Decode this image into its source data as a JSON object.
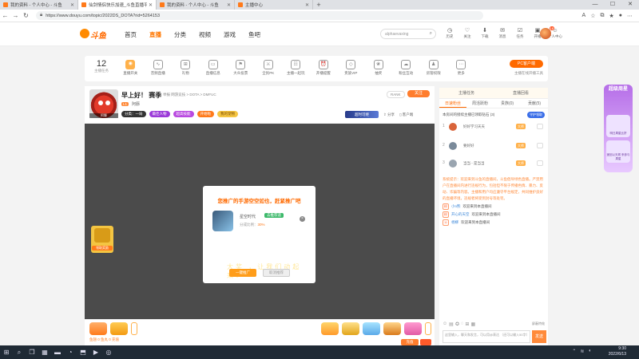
{
  "browser": {
    "tabs": [
      {
        "title": "我的资料 - 个人中心 - 斗鱼"
      },
      {
        "title": "仙剑情侣快乐加速_斗鱼直播平台"
      },
      {
        "title": "我的资料 - 个人中心 - 斗鱼"
      },
      {
        "title": "主播中心"
      }
    ],
    "url": "https://www.douyu.com/topic/2022DS_DOTA?rid=5264153"
  },
  "site": {
    "logo": "斗鱼",
    "nav": [
      "首页",
      "直播",
      "分类",
      "视频",
      "游戏",
      "鱼吧"
    ],
    "search_placeholder": "alphaevaxing",
    "header_icons": [
      {
        "icon": "history-icon",
        "label": "历史"
      },
      {
        "icon": "follow-icon",
        "label": "关注"
      },
      {
        "icon": "download-icon",
        "label": "下载"
      },
      {
        "icon": "message-icon",
        "label": "消息"
      },
      {
        "icon": "task-icon",
        "label": "任务"
      },
      {
        "icon": "gift-icon",
        "label": "开播"
      },
      {
        "icon": "user-icon",
        "label": "个人中心"
      }
    ],
    "avatar_badge": "18"
  },
  "funcbar": {
    "level": "12",
    "level_label": "主播任务",
    "items": [
      "直播开关",
      "音频直播",
      "礼物",
      "直播信息",
      "大众投票",
      "全民PK",
      "主播一起玩",
      "开播提醒",
      "贵族VIP",
      "抽奖",
      "粉丝互动",
      "房管权限",
      "更多"
    ],
    "pc_button": "PC客户端",
    "pc_link": "主播在线开播工具"
  },
  "room": {
    "title": "早上好！",
    "subtitle": "赛季",
    "meta": "举报  网游竞技 > DOTA > DMFUC",
    "host": "阿豚",
    "level": "L1",
    "tags": [
      "分类：一局",
      "最佳人物",
      "超高技能",
      "开始啦",
      "我的宠物"
    ],
    "report": "RANK",
    "follow": "关注",
    "pk_banner": "超时可继",
    "share": "分享",
    "fullscreen": "客户端"
  },
  "video": {
    "chest_label": "领取奖励",
    "modal": {
      "title": "您推广的手游空空如也，赶紧推广吧",
      "game_name": "星空时代",
      "game_badge": "去推荐道",
      "share_label": "分成比例：",
      "share_value": "30%",
      "ghost_text": "大奖 ，让我们动起来！",
      "primary_btn": "一键推广",
      "secondary_btn": "取消推荐"
    }
  },
  "giftbar": {
    "currency": "鱼翅 0 鱼丸 0 充值",
    "recharge": "充值"
  },
  "rpanel": {
    "top_tabs": [
      "主播任务",
      "直播回看"
    ],
    "tabs": [
      "日速粉丝",
      "周活跃粉",
      "贵族(0)",
      "贡献(5)"
    ],
    "guard_text": "本房间的接续主播已领取钻石 (3)",
    "guard_btn": "守护领取",
    "ranks": [
      {
        "rank": "1",
        "name": "好好学习天天",
        "lv": "大师"
      },
      {
        "rank": "2",
        "name": "要好好",
        "lv": "大师"
      },
      {
        "rank": "3",
        "name": "当当 - 是当当",
        "lv": "大师"
      }
    ],
    "chat": {
      "system": "系统提示：欢迎来到斗鱼的直播间，斗鱼倡导绿色直播。严禁用户在直播间内进行违规行为，包括但不限于传播色情、暴力、反动、诈骗等内容。主播和用户均应遵守平台规定，共同维护良好的直播环境，违规者将受到封号等处罚。",
      "lines": [
        {
          "badge": "粉",
          "user": "小n熊",
          "msg": "欢迎来到本直播间"
        },
        {
          "badge": "粉",
          "user": "开心的天空",
          "msg": "欢迎来到本直播间"
        },
        {
          "badge": "11",
          "user": "杨柳",
          "msg": "欢迎来到本直播间"
        }
      ]
    },
    "chat_right": "屏蔽特效",
    "input_placeholder": "这里输入，聊天和发言，可以用@表达 （还可以输入50字）",
    "send": "发送"
  },
  "promo": {
    "title": "超级周星",
    "cap1": "明日周星比拼",
    "cap2": "速回以天规 来参与周星"
  },
  "taskbar": {
    "time": "9:30",
    "date": "2022/6/13"
  }
}
